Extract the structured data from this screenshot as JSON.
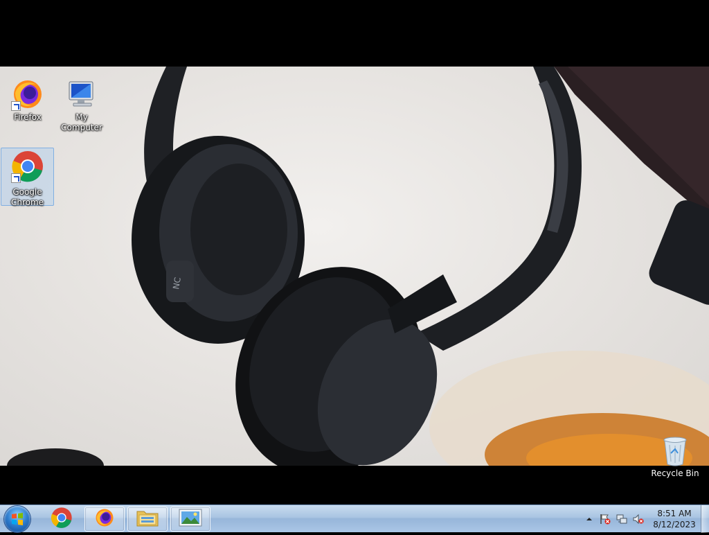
{
  "desktop": {
    "icons": {
      "firefox": {
        "label": "Firefox"
      },
      "my_computer": {
        "label": "My Computer"
      },
      "chrome": {
        "label": "Google Chrome"
      },
      "recycle_bin": {
        "label": "Recycle Bin"
      }
    },
    "wallpaper": {
      "subject": "black over-ear headphones on white desk",
      "printed_text": "NC"
    }
  },
  "taskbar": {
    "start_icon": "windows-logo-icon",
    "items": [
      {
        "name": "chrome",
        "icon": "chrome-icon",
        "state": "pinned"
      },
      {
        "name": "firefox",
        "icon": "firefox-icon",
        "state": "open"
      },
      {
        "name": "file-explorer",
        "icon": "folder-icon",
        "state": "open"
      },
      {
        "name": "image-viewer",
        "icon": "picture-icon",
        "state": "open"
      }
    ],
    "tray": {
      "icons": [
        "show-hidden-icons-arrow",
        "action-center-flag-icon",
        "network-icon",
        "volume-muted-icon"
      ],
      "time": "8:51 AM",
      "date": "8/12/2023"
    }
  },
  "colors": {
    "taskbar_top": "#c9dcef",
    "taskbar_bottom": "#aac6e6",
    "selection": "#aacdf0",
    "letterbox": "#000000"
  }
}
